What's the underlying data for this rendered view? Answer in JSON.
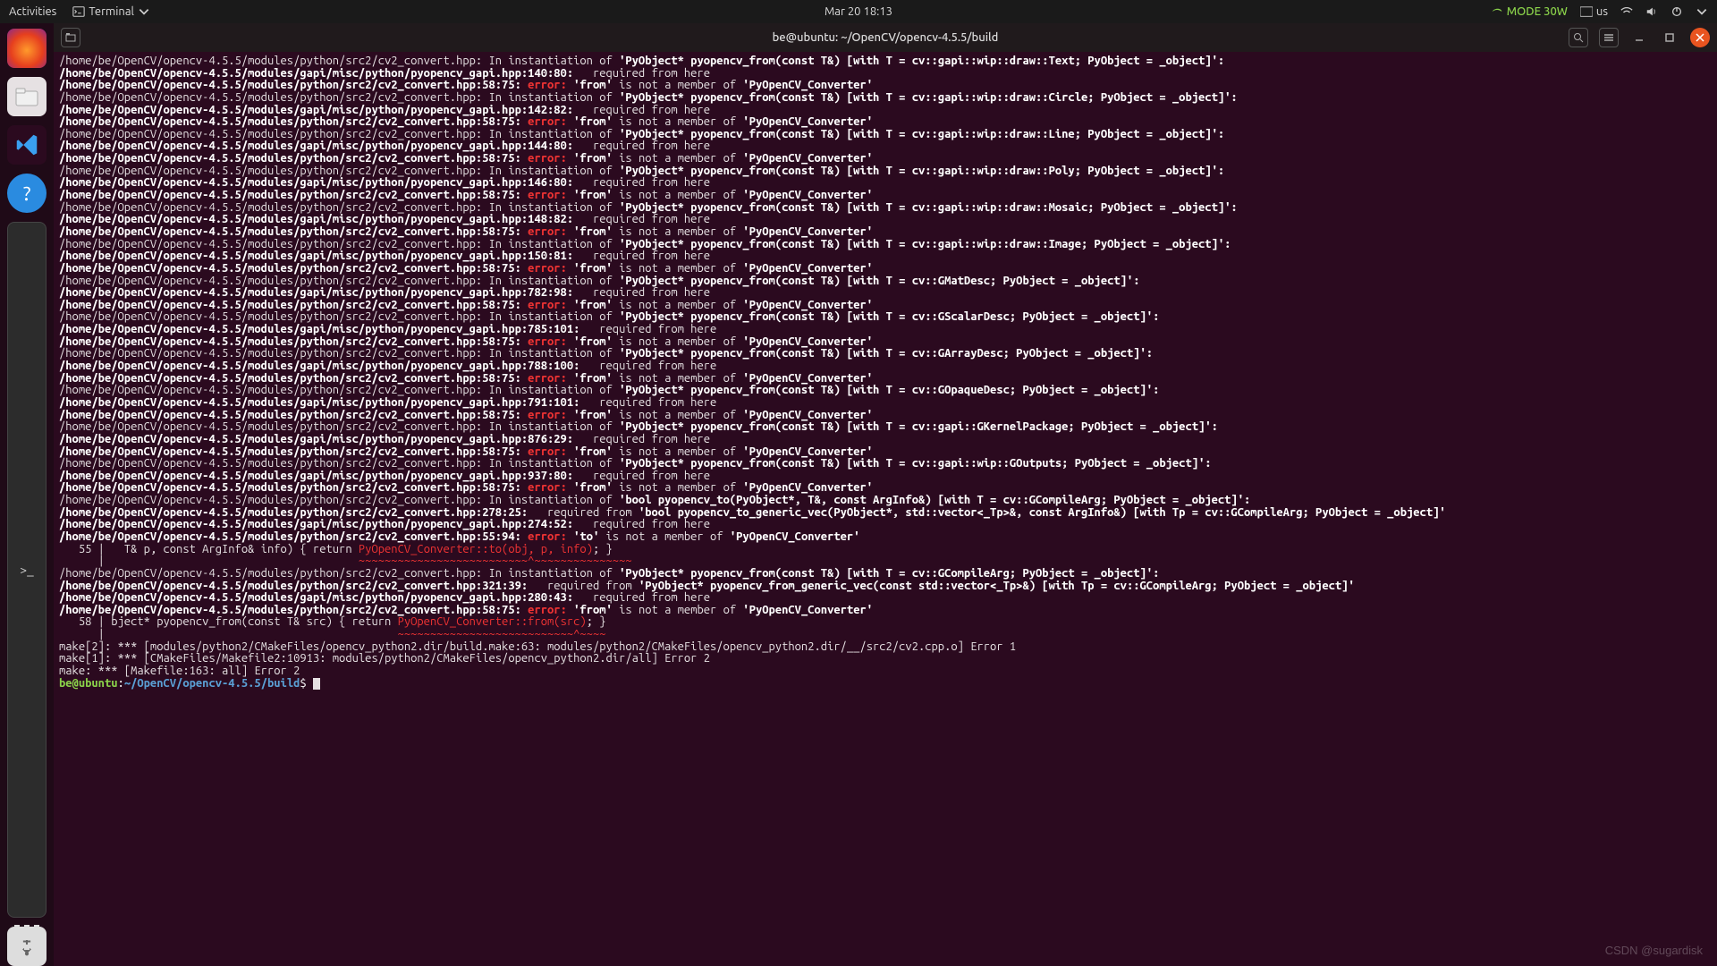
{
  "top_bar": {
    "activities": "Activities",
    "terminal_menu": "Terminal",
    "clock": "Mar 20  18:13",
    "mode": "MODE 30W",
    "kbd": "us"
  },
  "window": {
    "title": "be@ubuntu: ~/OpenCV/opencv-4.5.5/build"
  },
  "prompt": {
    "userhost": "be@ubuntu",
    "path": "~/OpenCV/opencv-4.5.5/build",
    "sep": ":",
    "dollar": "$"
  },
  "watermark": "CSDN @sugardisk",
  "paths": {
    "convert": "/home/be/OpenCV/opencv-4.5.5/modules/python/src2/cv2_convert.hpp",
    "gapi": "/home/be/OpenCV/opencv-4.5.5/modules/gapi/misc/python/pyopencv_gapi.hpp"
  },
  "strings": {
    "instantiation": ": In instantiation of ",
    "req_from_here": "required from here",
    "req_from": "required from",
    "error": "error:",
    "from_not_member": " is not a member of ",
    "to_not_member": " is not a member of ",
    "from_q": "'from'",
    "to_q": "'to'"
  },
  "types": {
    "text": "cv::gapi::wip::draw::Text",
    "circle": "cv::gapi::wip::draw::Circle",
    "line": "cv::gapi::wip::draw::Line",
    "poly": "cv::gapi::wip::draw::Poly",
    "mosaic": "cv::gapi::wip::draw::Mosaic",
    "image": "cv::gapi::wip::draw::Image",
    "gmat": "cv::GMatDesc",
    "gscalar": "cv::GScalarDesc",
    "garray": "cv::GArrayDesc",
    "gopaque": "cv::GOpaqueDesc",
    "gkernel": "cv::gapi::GKernelPackage",
    "goutputs": "cv::gapi::wip::GOutputs",
    "gcompile": "cv::GCompileArg"
  },
  "locs": {
    "c58_75": ":58:75:",
    "g140_80": ":140:80:",
    "g142_82": ":142:82:",
    "g144_80": ":144:80:",
    "g146_80": ":146:80:",
    "g148_82": ":148:82:",
    "g150_81": ":150:81:",
    "g782_98": ":782:98:",
    "g785_101": ":785:101:",
    "g788_100": ":788:100:",
    "g791_101": ":791:101:",
    "g876_29": ":876:29:",
    "g937_80": ":937:80:",
    "c278_25": ":278:25:",
    "g274_52": ":274:52:",
    "c55_94": ":55:94:",
    "c321_39": ":321:39:",
    "g280_43": ":280:43:"
  },
  "snippet": {
    "l55_num": "   55 |",
    "l55_code": "   T& p, const ArgInfo& info) { return ",
    "l55_hl": "PyOpenCV_Converter<T>::to(obj, p, info)",
    "l55_tail": "; }",
    "l55_bar": "      |",
    "l55_tilde": "                                       ~~~~~~~~~~~~~~~~~~~~~~~~~~^~~~~~~~~~~~~~~~",
    "l58_num": "   58 |",
    "l58_code": " bject* pyopencv_from(const T& src) { return ",
    "l58_hl": "PyOpenCV_Converter<T>::from(src)",
    "l58_tail": "; }",
    "l58_bar": "      |",
    "l58_tilde": "                                             ~~~~~~~~~~~~~~~~~~~~~~~~~~~^~~~~"
  },
  "bool_to": "'bool pyopencv_to(PyObject*, T&, const ArgInfo&) [with T = cv::GCompileArg; PyObject = _object]'",
  "bool_to_vec": "'bool pyopencv_to_generic_vec(PyObject*, std::vector<_Tp>&, const ArgInfo&) [with Tp = cv::GCompileArg; PyObject = _object]'",
  "from_vec": "'PyObject* pyopencv_from_generic_vec(const std::vector<_Tp>&) [with Tp = cv::GCompileArg; PyObject = _object]'",
  "make_lines": {
    "m2": "make[2]: *** [modules/python2/CMakeFiles/opencv_python2.dir/build.make:63: modules/python2/CMakeFiles/opencv_python2.dir/__/src2/cv2.cpp.o] Error 1",
    "m1": "make[1]: *** [CMakeFiles/Makefile2:10913: modules/python2/CMakeFiles/opencv_python2.dir/all] Error 2",
    "m0": "make: *** [Makefile:163: all] Error 2"
  }
}
